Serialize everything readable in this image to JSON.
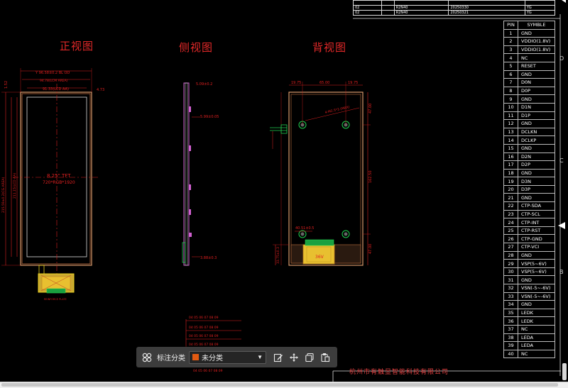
{
  "views": {
    "front_title": "正视图",
    "side_title": "侧视图",
    "back_title": "背视图"
  },
  "front": {
    "dim_top_1": "Y 96.58±0.2 BL OD",
    "dim_top_2": "94.78(LCM AREA)",
    "dim_top_3": "91.33(LCD AA)",
    "dim_right": "4.73",
    "dim_left": "1.52",
    "center_line1": "8.25\" TFT",
    "center_line2": "720*RGB*1920",
    "left_dim_1": "215.59±0.2(CG AREA)",
    "left_dim_2": "211.15(LCD AA)",
    "fpc_note": "REINFORCE PLATE"
  },
  "side": {
    "dim_top": "5.09±0.2",
    "dim_mid": "5.99±0.05",
    "dim_bottom": "3.88±0.3"
  },
  "back": {
    "dim_top_left": "19.75",
    "dim_top_mid": "65.00",
    "dim_top_right": "19.75",
    "dim_right_top": "47.00",
    "dim_right_mid": "162.50",
    "dim_right_bottom": "47.00",
    "hole_note": "4-M2.5*3 (MAX)",
    "dim_lower": "40.51±0.5",
    "dim_left_bottom": "33.75±0.3",
    "fpc_label": "36V"
  },
  "revision_table": {
    "rows": [
      [
        "",
        "",
        "",
        "",
        ""
      ],
      [
        "02",
        "",
        "R2N40",
        "20250330",
        "YG"
      ],
      [
        "02",
        "",
        "R2N40",
        "20250321",
        "YG"
      ]
    ]
  },
  "pin_table": {
    "header": [
      "PIN",
      "SYMBLE"
    ],
    "rows": [
      [
        "1",
        "GND"
      ],
      [
        "2",
        "VDDIO(1.8V)"
      ],
      [
        "3",
        "VDDIO(1.8V)"
      ],
      [
        "4",
        "NC"
      ],
      [
        "5",
        "RESET"
      ],
      [
        "6",
        "GND"
      ],
      [
        "7",
        "D0N"
      ],
      [
        "8",
        "D0P"
      ],
      [
        "9",
        "GND"
      ],
      [
        "10",
        "D1N"
      ],
      [
        "11",
        "D1P"
      ],
      [
        "12",
        "GND"
      ],
      [
        "13",
        "DCLKN"
      ],
      [
        "14",
        "DCLKP"
      ],
      [
        "15",
        "GND"
      ],
      [
        "16",
        "D2N"
      ],
      [
        "17",
        "D2P"
      ],
      [
        "18",
        "GND"
      ],
      [
        "19",
        "D3N"
      ],
      [
        "20",
        "D3P"
      ],
      [
        "21",
        "GND"
      ],
      [
        "22",
        "CTP-SDA"
      ],
      [
        "23",
        "CTP-SCL"
      ],
      [
        "24",
        "CTP-INT"
      ],
      [
        "25",
        "CTP-RST"
      ],
      [
        "26",
        "CTP-GND"
      ],
      [
        "27",
        "CTP-VCI"
      ],
      [
        "28",
        "GND"
      ],
      [
        "29",
        "VSP(5~6V)"
      ],
      [
        "30",
        "VSP(5~6V)"
      ],
      [
        "31",
        "GND"
      ],
      [
        "32",
        "VSN(-5~-6V)"
      ],
      [
        "33",
        "VSN(-5~-6V)"
      ],
      [
        "34",
        "GND"
      ],
      [
        "35",
        "LEDK"
      ],
      [
        "36",
        "LEDK"
      ],
      [
        "37",
        "NC"
      ],
      [
        "38",
        "LEDA"
      ],
      [
        "39",
        "LEDA"
      ],
      [
        "40",
        "NC"
      ]
    ]
  },
  "zones": {
    "d": "D",
    "c": "C",
    "b": "B"
  },
  "company": "杭州市有触显智能科技有限公司",
  "toolbar": {
    "label": "标注分类",
    "category": "未分类",
    "category_color": "#e25a12"
  }
}
